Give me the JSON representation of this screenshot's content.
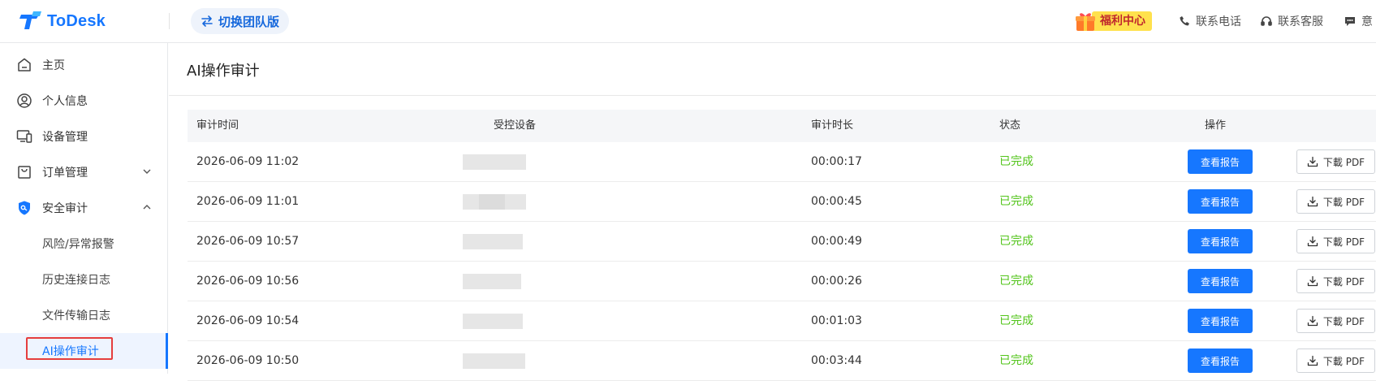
{
  "app": {
    "name": "ToDesk"
  },
  "header": {
    "switch_label": "切换团队版",
    "benefit_label": "福利中心",
    "links": [
      {
        "icon": "phone-icon",
        "label": "联系电话"
      },
      {
        "icon": "headset-icon",
        "label": "联系客服"
      },
      {
        "icon": "message-icon",
        "label": "意"
      }
    ]
  },
  "sidebar": {
    "items": [
      {
        "icon": "home-icon",
        "label": "主页"
      },
      {
        "icon": "user-icon",
        "label": "个人信息"
      },
      {
        "icon": "devices-icon",
        "label": "设备管理"
      },
      {
        "icon": "bag-icon",
        "label": "订单管理",
        "expandable": true,
        "expanded": false
      },
      {
        "icon": "shield-icon",
        "label": "安全审计",
        "expandable": true,
        "expanded": true
      }
    ],
    "sub_items": [
      {
        "label": "风险/异常报警"
      },
      {
        "label": "历史连接日志"
      },
      {
        "label": "文件传输日志"
      },
      {
        "label": "AI操作审计",
        "active": true
      }
    ]
  },
  "main": {
    "title": "AI操作审计",
    "table": {
      "columns": [
        "审计时间",
        "受控设备",
        "审计时长",
        "状态",
        "操作"
      ],
      "rows": [
        {
          "time": "2026-06-09 11:02",
          "duration": "00:00:17",
          "status": "已完成",
          "report": "查看报告",
          "pdf": "下載 PDF"
        },
        {
          "time": "2026-06-09 11:01",
          "duration": "00:00:45",
          "status": "已完成",
          "report": "查看报告",
          "pdf": "下載 PDF"
        },
        {
          "time": "2026-06-09 10:57",
          "duration": "00:00:49",
          "status": "已完成",
          "report": "查看报告",
          "pdf": "下載 PDF"
        },
        {
          "time": "2026-06-09 10:56",
          "duration": "00:00:26",
          "status": "已完成",
          "report": "查看报告",
          "pdf": "下載 PDF"
        },
        {
          "time": "2026-06-09 10:54",
          "duration": "00:01:03",
          "status": "已完成",
          "report": "查看报告",
          "pdf": "下載 PDF"
        },
        {
          "time": "2026-06-09 10:50",
          "duration": "00:03:44",
          "status": "已完成",
          "report": "查看报告",
          "pdf": "下載 PDF"
        }
      ]
    }
  },
  "colors": {
    "accent": "#1677ff",
    "status_done": "#52c41a",
    "benefit_bg": "#ffe14d",
    "benefit_text": "#c0282d",
    "highlight_box": "#e53e3e"
  }
}
